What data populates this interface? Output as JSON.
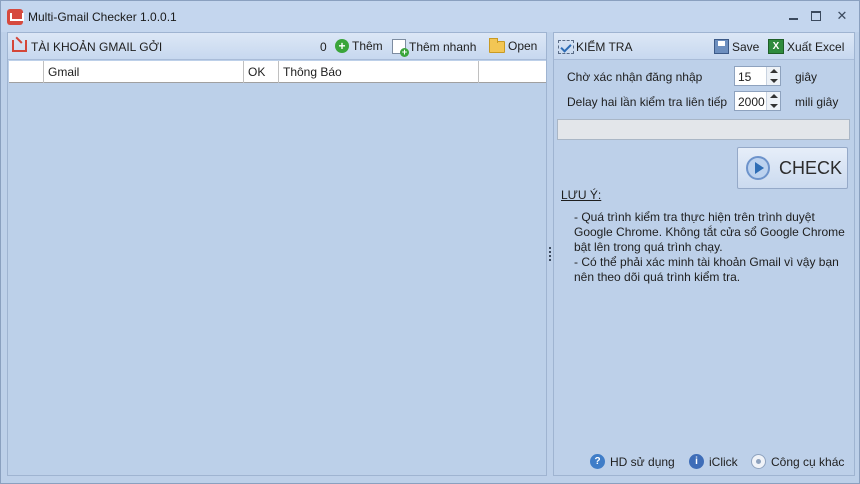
{
  "window": {
    "title": "Multi-Gmail Checker  1.0.0.1"
  },
  "left": {
    "title": "TÀI KHOẢN GMAIL GỞI",
    "count": "0",
    "add_label": "Thêm",
    "quick_add_label": "Thêm nhanh",
    "open_label": "Open",
    "columns": [
      "",
      "Gmail",
      "OK",
      "Thông Báo",
      ""
    ]
  },
  "right": {
    "title": "KIỂM TRA",
    "save_label": "Save",
    "export_label": "Xuất Excel",
    "login_wait": {
      "label": "Chờ xác nhận đăng nhập",
      "value": "15",
      "unit": "giây"
    },
    "delay": {
      "label": "Delay hai lần kiểm tra liên tiếp",
      "value": "2000",
      "unit": "mili giây"
    },
    "progress": 0,
    "check_label": "CHECK",
    "note_title": "LƯU Ý:",
    "notes": [
      "- Quá trình kiểm tra thực hiện trên trình duyệt",
      "Google Chrome. Không tắt cửa sổ Google Chrome",
      "bật lên trong quá trình chạy.",
      "- Có thể phải xác minh tài khoản Gmail vì vậy bạn",
      "nên theo dõi quá trình kiểm tra."
    ],
    "footer": {
      "help_label": "HD sử dụng",
      "iclick_label": "iClick",
      "tools_label": "Công cụ khác"
    }
  },
  "icons": {
    "app": "gmail-checker-icon",
    "add": "plus-circle-icon",
    "quick_add": "document-plus-icon",
    "open": "folder-icon",
    "check": "checklist-icon",
    "save": "save-icon",
    "export": "excel-icon",
    "run": "play-icon",
    "help": "help-icon",
    "info": "info-icon",
    "tools": "tools-icon"
  },
  "colors": {
    "background": "#bdd0e9",
    "header": "#d3e1f4",
    "accent": "#2e6db5"
  }
}
